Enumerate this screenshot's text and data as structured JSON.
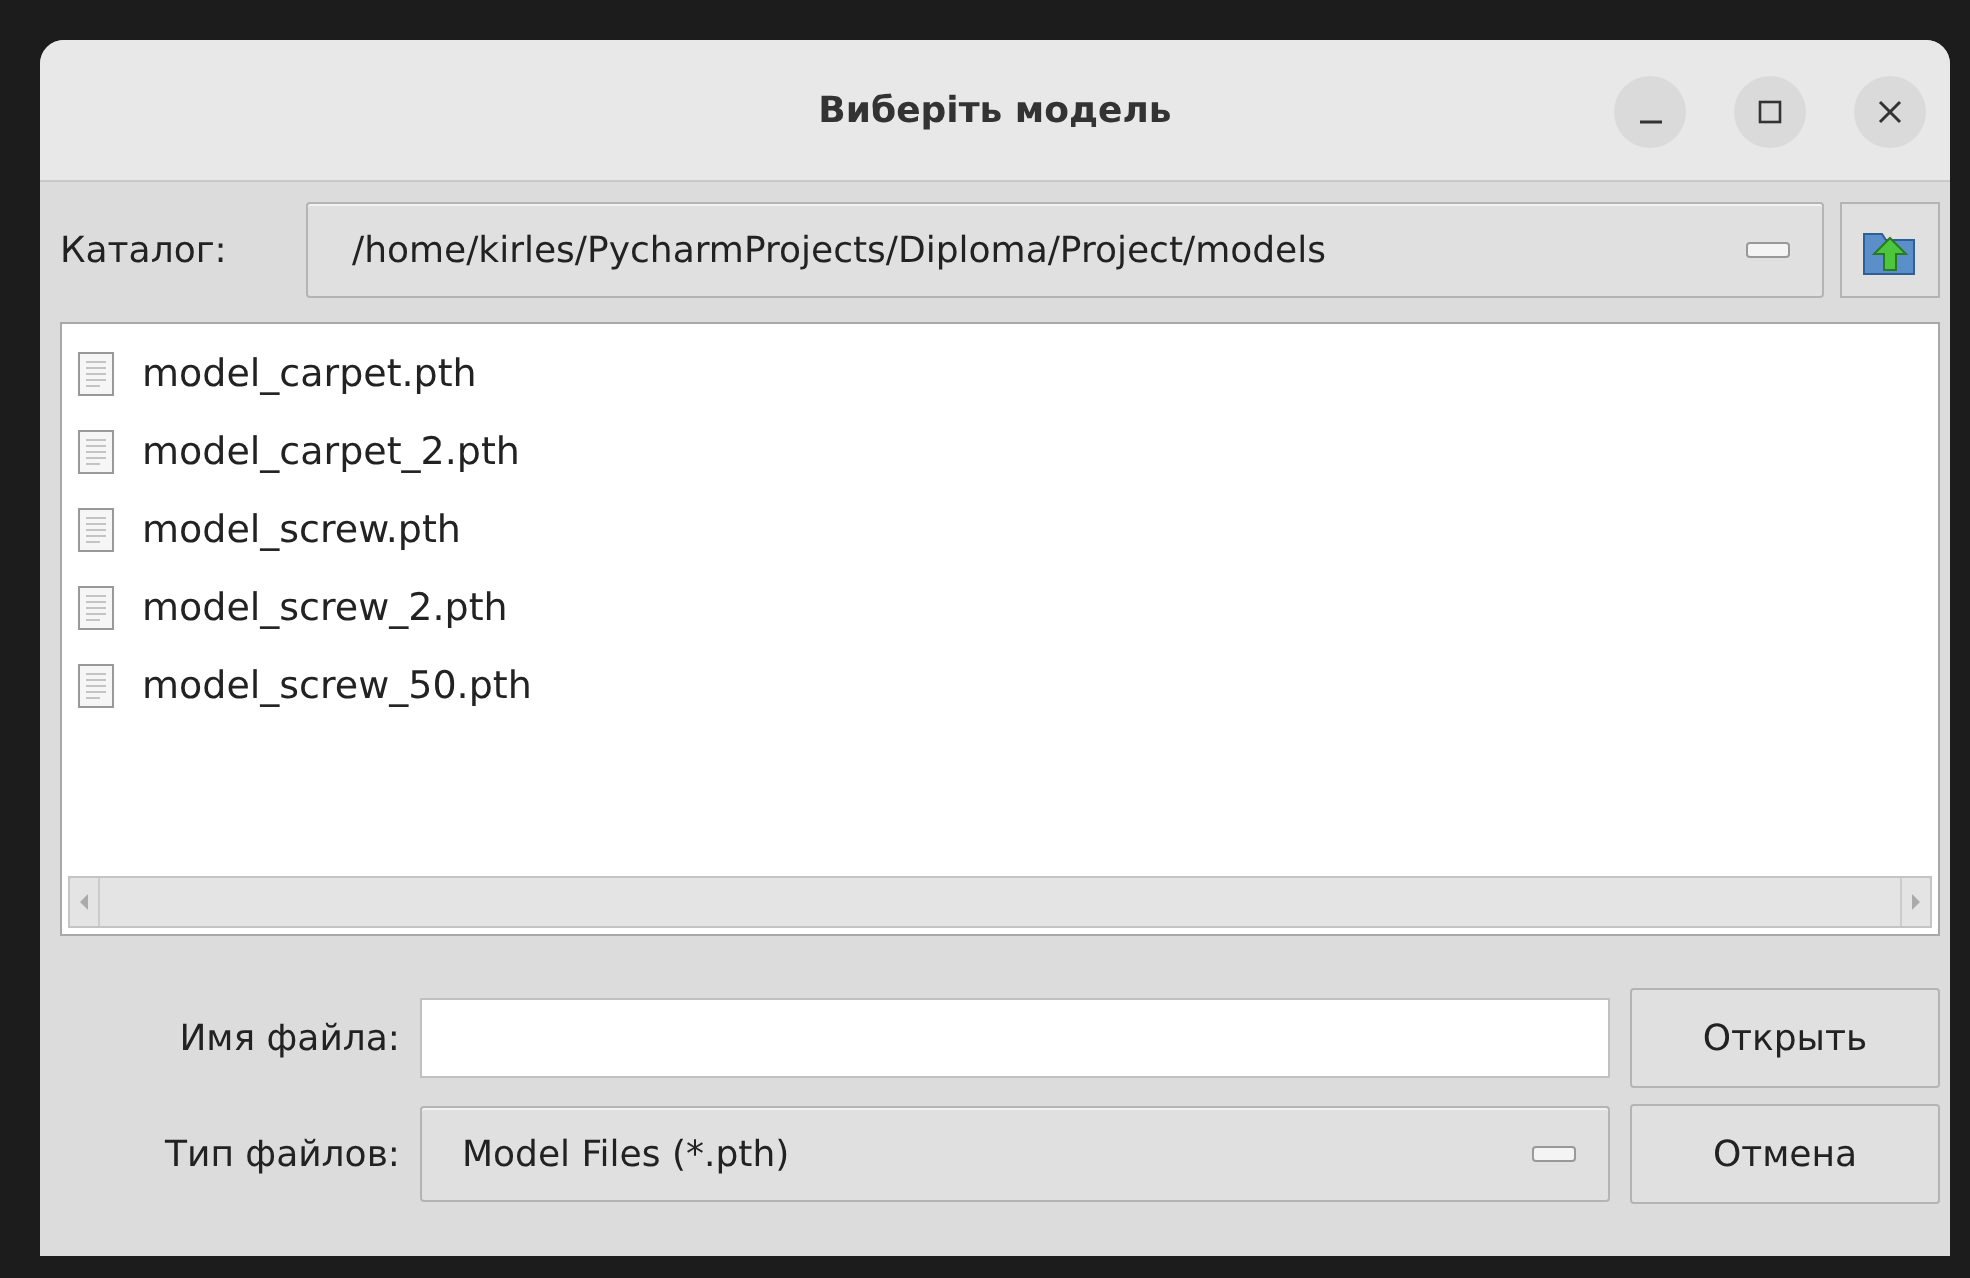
{
  "window": {
    "title": "Виберіть модель"
  },
  "directory": {
    "label": "Каталог:",
    "path": "/home/kirles/PycharmProjects/Diploma/Project/models"
  },
  "files": [
    {
      "name": "model_carpet.pth"
    },
    {
      "name": "model_carpet_2.pth"
    },
    {
      "name": "model_screw.pth"
    },
    {
      "name": "model_screw_2.pth"
    },
    {
      "name": "model_screw_50.pth"
    }
  ],
  "filename": {
    "label": "Имя файла:"
  },
  "filetype": {
    "label": "Тип файлов:",
    "value": "Model Files (*.pth)"
  },
  "buttons": [
    {
      "label": "Открыть"
    },
    {
      "label": "Отмена"
    }
  ]
}
